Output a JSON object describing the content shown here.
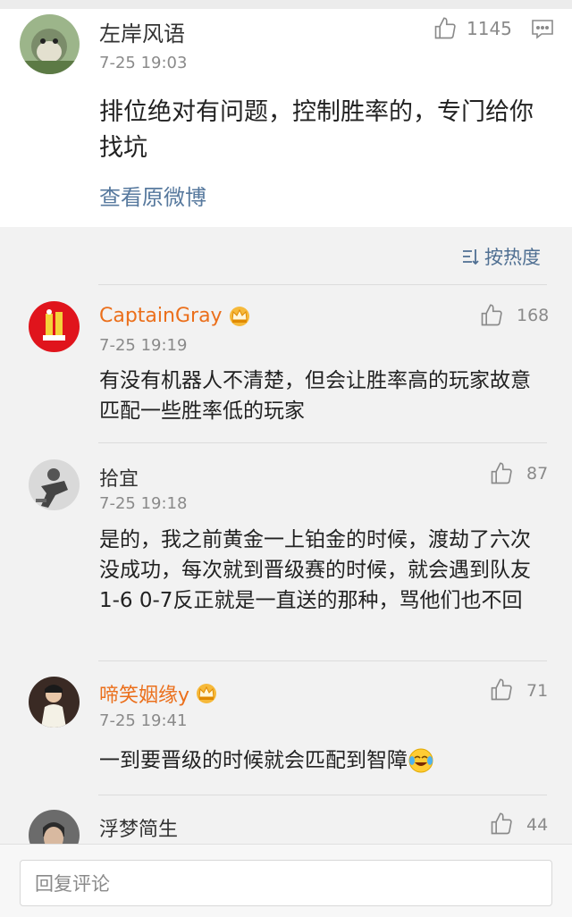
{
  "post": {
    "author": "左岸风语",
    "time": "7-25 19:03",
    "like_count": "1145",
    "text": "排位绝对有问题，控制胜率的，专门给你找坑",
    "view_original": "查看原微博"
  },
  "sort": {
    "label": "按热度"
  },
  "comments": [
    {
      "author": "CaptainGray",
      "time": "7-25 19:19",
      "likes": "168",
      "text": "有没有机器人不清楚，但会让胜率高的玩家故意匹配一些胜率低的玩家"
    },
    {
      "author": "拾宜",
      "time": "7-25 19:18",
      "likes": "87",
      "text": "是的，我之前黄金一上铂金的时候，渡劫了六次没成功，每次就到晋级赛的时候，就会遇到队友1-6 0-7反正就是一直送的那种，骂他们也不回"
    },
    {
      "author": "啼笑姻缘y",
      "time": "7-25 19:41",
      "likes": "71",
      "text": "一到要晋级的时候就会匹配到智障"
    },
    {
      "author": "浮梦简生",
      "likes": "44"
    }
  ],
  "reply": {
    "placeholder": "回复评论"
  },
  "colors": {
    "accent_link": "#57799e",
    "vip_name": "#eb6f1b"
  }
}
